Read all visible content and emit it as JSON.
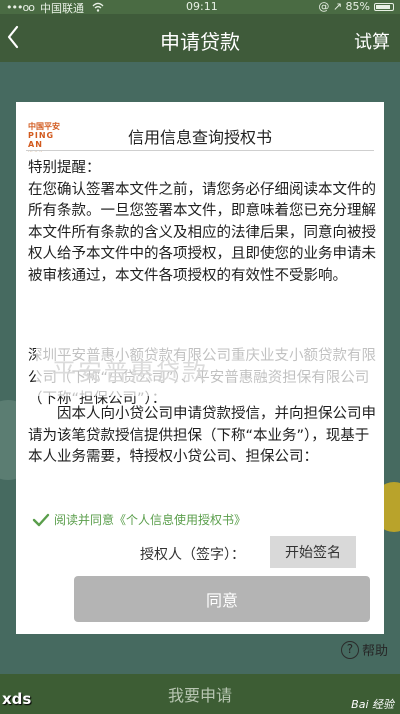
{
  "status_bar": {
    "signal": "•••oo",
    "carrier": "中国联通",
    "wifi_icon": "wifi-icon",
    "time": "09:11",
    "right_icons": "@ ↗",
    "battery": "85%",
    "battery_level": 0.85
  },
  "nav": {
    "back_icon": "chevron-left-icon",
    "title": "申请贷款",
    "trial_label": "试算"
  },
  "document": {
    "logo_cn": "中国平安",
    "logo_en": "PING AN",
    "title": "信用信息查询授权书",
    "notice_heading": "特别提醒：",
    "notice_text": "在您确认签署本文件之前，请您务必仔细阅读本文件的所有条款。一旦您签署本文件，即意味着您已充分理解本文件所有条款的含义及相应的法律后果，同意向被授权人给予本文件中的各项授权，且即使您的业务申请未被审核通过，本文件各项授权的有效性不受影响。",
    "party_text": "深圳平安普惠小额贷款有限公司重庆业支小额贷款有限公司（下称“小贷公司”）、平安普惠融资担保有限公司（下称“担保公司”）：",
    "body_text": "因本人向小贷公司申请贷款授信，并向担保公司申请为该笔贷款授信提供担保（下称“本业务”），现基于本人业务需要，特授权小贷公司、担保公司："
  },
  "watermark_text": "平安普惠贷款",
  "agreement": {
    "check_icon": "checkmark-icon",
    "label": "阅读并同意《个人信息使用授权书》"
  },
  "sign": {
    "label": "授权人（签字）：",
    "button": "开始签名"
  },
  "agree_button": "同意",
  "help": {
    "icon": "question-icon",
    "label": "帮助"
  },
  "bottom": {
    "apply_button": "我要申请",
    "overlay_left": "xds",
    "overlay_right": "Bai 经验"
  },
  "colors": {
    "nav_bg": "#3f5b3a",
    "accent_green": "#5a9e4b",
    "disabled_button": "#b4b4b4"
  }
}
